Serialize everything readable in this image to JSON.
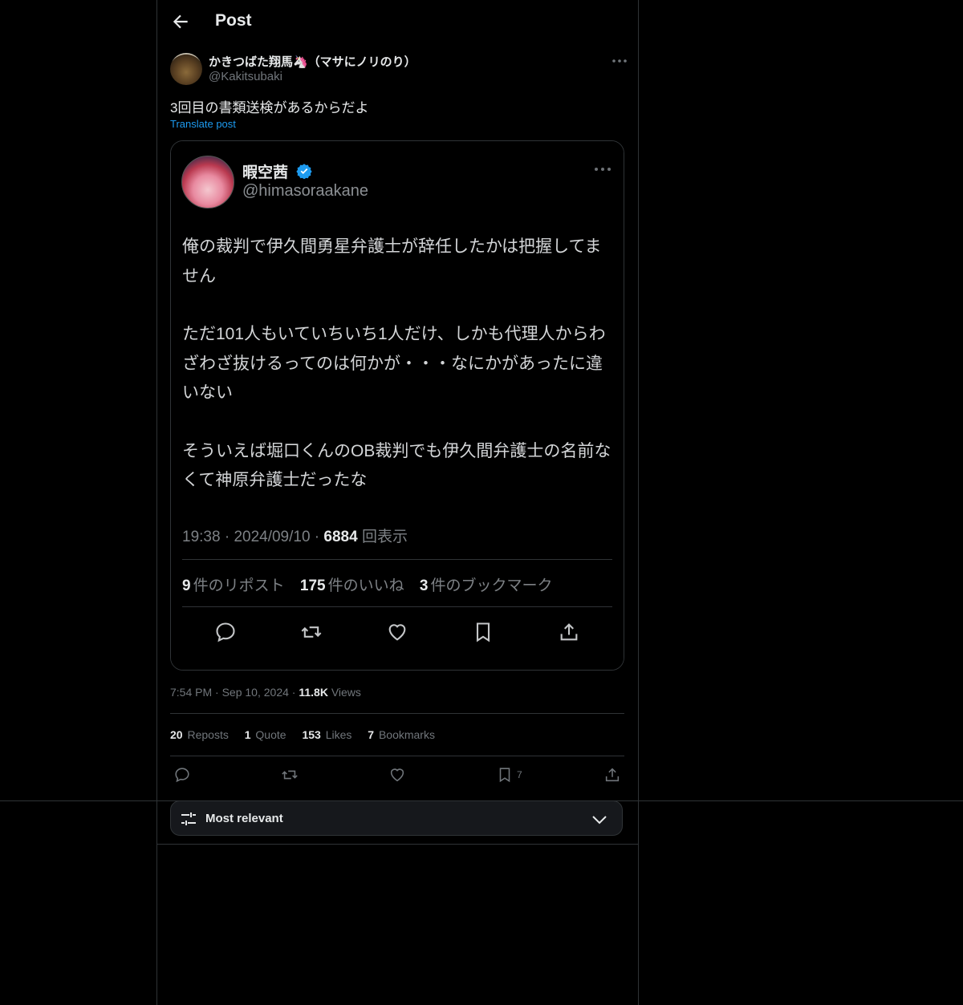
{
  "header": {
    "title": "Post"
  },
  "post": {
    "display_name": "かきつばた翔馬🦄（マサにノリのり）",
    "handle": "@Kakitsubaki",
    "text": "3回目の書類送検があるからだよ",
    "translate_label": "Translate post",
    "time": "7:54 PM",
    "date": "Sep 10, 2024",
    "views_count": "11.8K",
    "views_label": "Views"
  },
  "quote": {
    "display_name": "暇空茜",
    "handle": "@himasoraakane",
    "paragraphs": [
      "俺の裁判で伊久間勇星弁護士が辞任したかは把握してません",
      "ただ101人もいていちいち1人だけ、しかも代理人からわざわざ抜けるってのは何かが・・・なにかがあったに違いない",
      "そういえば堀口くんのOB裁判でも伊久間弁護士の名前なくて神原弁護士だったな"
    ],
    "time": "19:38",
    "date": "2024/09/10",
    "views_count": "6884",
    "views_label": "回表示",
    "reposts_count": "9",
    "reposts_label": "件のリポスト",
    "likes_count": "175",
    "likes_label": "件のいいね",
    "bookmarks_count": "3",
    "bookmarks_label": "件のブックマーク"
  },
  "stats": {
    "reposts_count": "20",
    "reposts_label": "Reposts",
    "quotes_count": "1",
    "quotes_label": "Quote",
    "likes_count": "153",
    "likes_label": "Likes",
    "bookmarks_count": "7",
    "bookmarks_label": "Bookmarks"
  },
  "actions": {
    "bookmark_count": "7"
  },
  "sort": {
    "label": "Most relevant"
  },
  "colors": {
    "background": "#000000",
    "accent": "#1d9bf0",
    "border": "#2f3336",
    "muted": "#71767b"
  },
  "icons": [
    "back-arrow-icon",
    "more-icon",
    "verified-icon",
    "reply-icon",
    "repost-icon",
    "like-icon",
    "bookmark-icon",
    "share-icon",
    "sliders-icon",
    "chevron-down-icon"
  ]
}
